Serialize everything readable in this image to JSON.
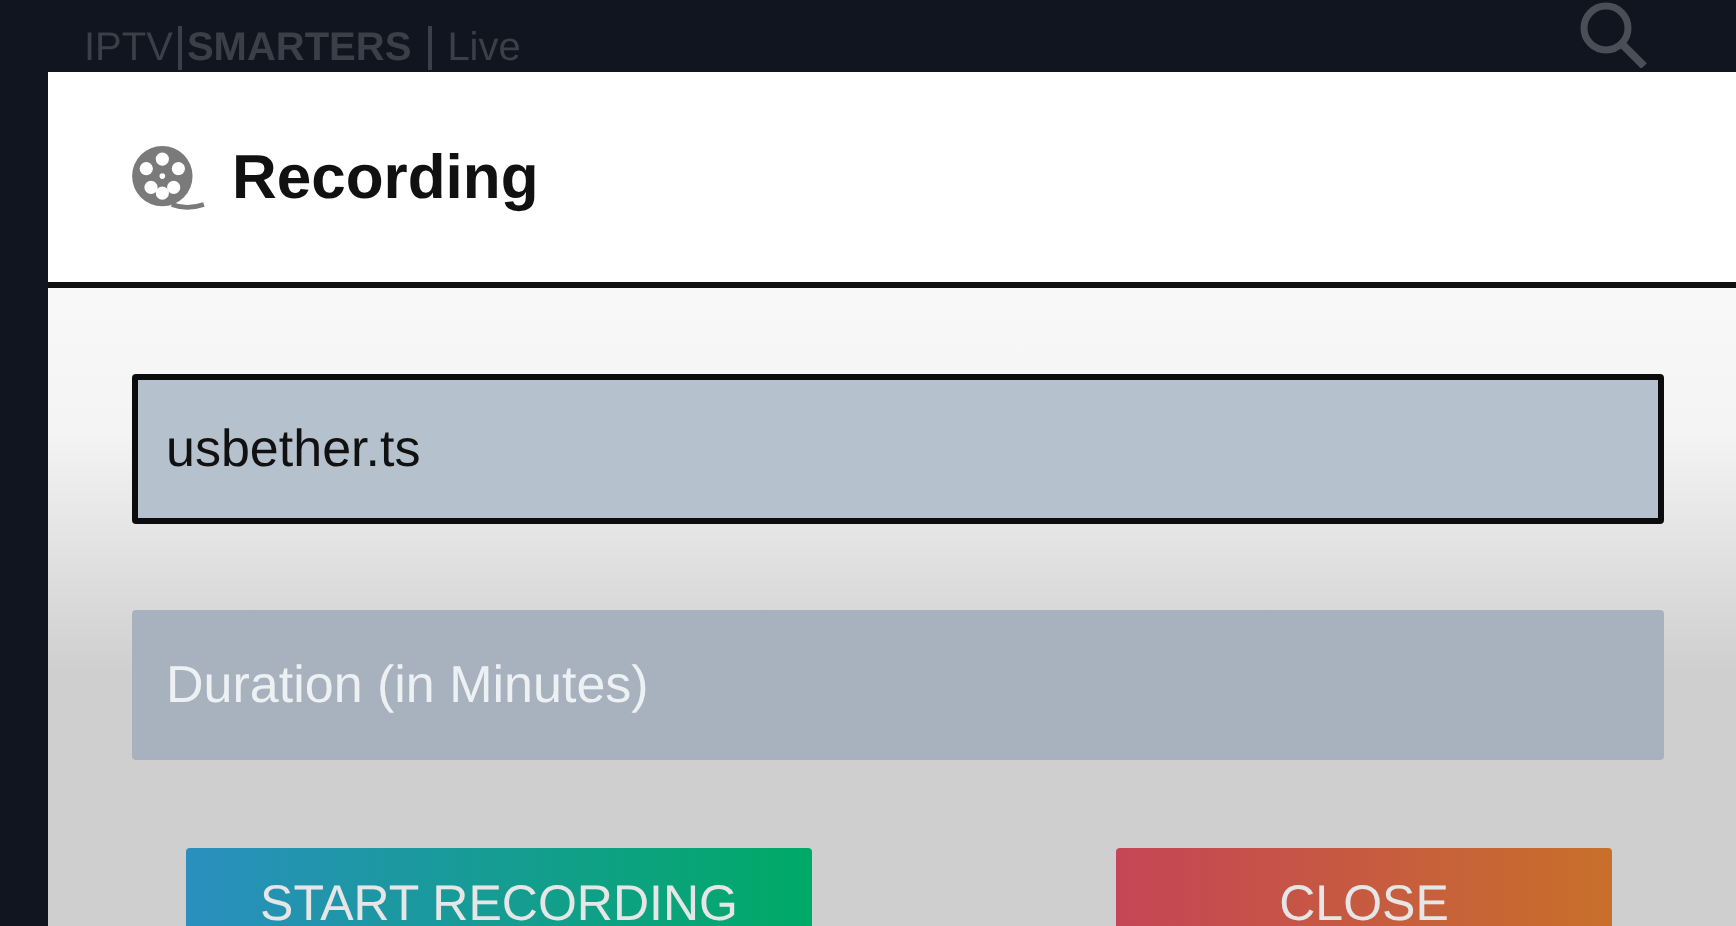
{
  "app_header": {
    "logo": "IPTV",
    "brand": "SMARTERS",
    "section": "Live"
  },
  "dialog": {
    "title": "Recording",
    "file_name": {
      "value": "usbether.ts",
      "focused": true
    },
    "duration": {
      "placeholder": "Duration (in Minutes)",
      "focused": false
    },
    "buttons": [
      {
        "label": "START RECORDING",
        "kind": "primary"
      },
      {
        "label": "CLOSE",
        "kind": "cancel"
      }
    ]
  }
}
